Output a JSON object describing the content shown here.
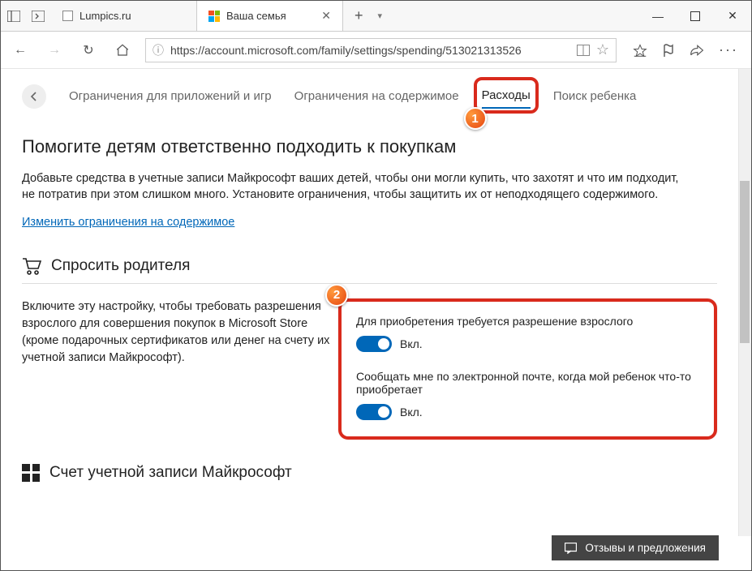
{
  "window": {
    "tab1": "Lumpics.ru",
    "tab2": "Ваша семья"
  },
  "addressbar": {
    "url": "https://account.microsoft.com/family/settings/spending/513021313526"
  },
  "nav": {
    "item1": "Ограничения для приложений и игр",
    "item2": "Ограничения на содержимое",
    "item3": "Расходы",
    "item4": "Поиск ребенка"
  },
  "page": {
    "heading": "Помогите детям ответственно подходить к покупкам",
    "paragraph": "Добавьте средства в учетные записи Майкрософт ваших детей, чтобы они могли купить, что захотят и что им подходит, не потратив при этом слишком много. Установите ограничения, чтобы защитить их от неподходящего содержимого.",
    "link": "Изменить ограничения на содержимое"
  },
  "ask_parent": {
    "title": "Спросить родителя",
    "desc": "Включите эту настройку, чтобы требовать разрешения взрослого для совершения покупок в Microsoft Store (кроме подарочных сертификатов или денег на счету их учетной записи Майкрософт).",
    "setting1_label": "Для приобретения требуется разрешение взрослого",
    "setting1_state": "Вкл.",
    "setting2_label": "Сообщать мне по электронной почте, когда мой ребенок что-то приобретает",
    "setting2_state": "Вкл."
  },
  "account_section": {
    "title": "Счет учетной записи Майкрософт"
  },
  "feedback": {
    "label": "Отзывы и предложения"
  },
  "badges": {
    "b1": "1",
    "b2": "2"
  }
}
